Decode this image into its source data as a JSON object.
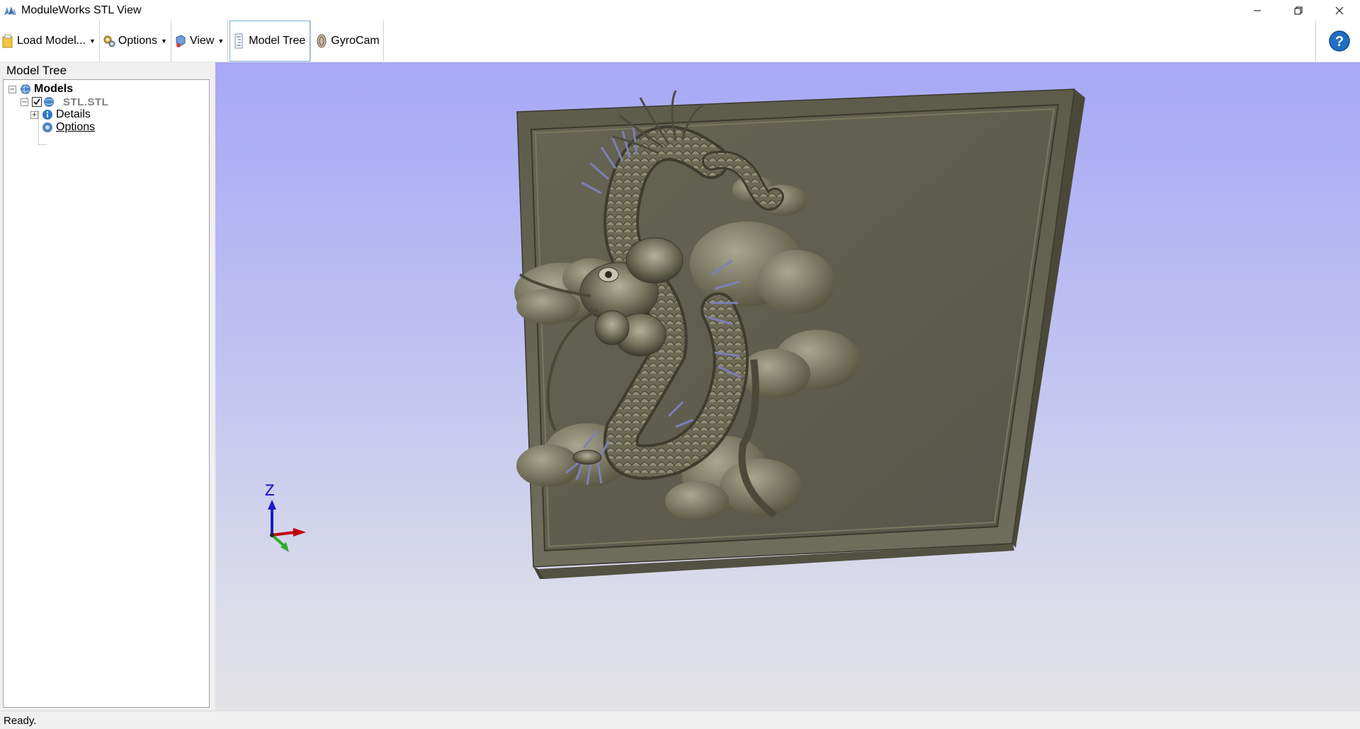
{
  "window": {
    "title": "ModuleWorks STL View",
    "controls": {
      "minimize_icon": "minimize-icon",
      "restore_icon": "restore-icon",
      "close_icon": "close-icon"
    }
  },
  "toolbar": {
    "load_model": "Load Model...",
    "options": "Options",
    "view": "View",
    "model_tree": "Model Tree",
    "gyrocam": "GyroCam",
    "help_icon": "help-icon"
  },
  "model_tree": {
    "title": "Model Tree",
    "root": "Models",
    "model_name": "STL.STL",
    "model_checked": true,
    "children": [
      "Details",
      "Options"
    ]
  },
  "viewport": {
    "axis_label_z": "Z",
    "colors": {
      "background_top": "#a7a8f6",
      "background_bottom": "#e3e3e6",
      "model": "#6d6b59",
      "axis_x": "#c00000",
      "axis_y": "#2eaa2e",
      "axis_z": "#1c1ccc"
    }
  },
  "status": {
    "text": "Ready."
  }
}
